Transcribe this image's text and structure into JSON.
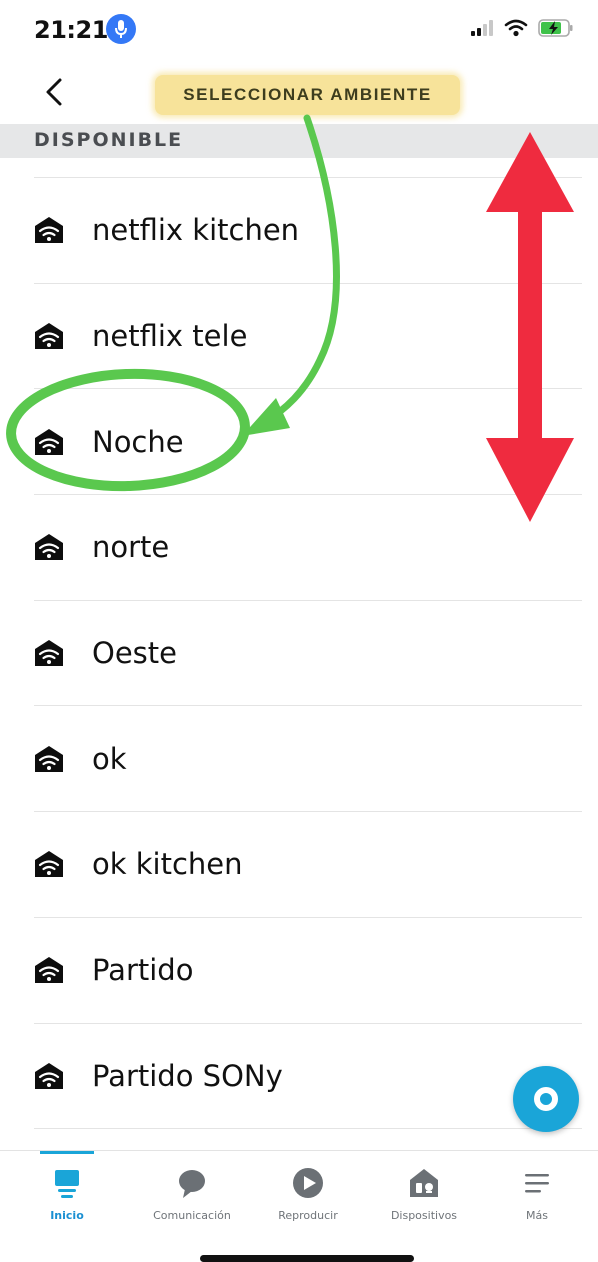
{
  "status": {
    "time": "21:21"
  },
  "header": {
    "title": "SELECCIONAR AMBIENTE"
  },
  "section": {
    "title": "DISPONIBLE"
  },
  "items": [
    {
      "label": "netflix kitchen"
    },
    {
      "label": "netflix tele"
    },
    {
      "label": "Noche"
    },
    {
      "label": "norte"
    },
    {
      "label": "Oeste"
    },
    {
      "label": "ok"
    },
    {
      "label": "ok kitchen"
    },
    {
      "label": "Partido"
    },
    {
      "label": "Partido SONy"
    }
  ],
  "nav": {
    "items": [
      {
        "label": "Inicio",
        "icon": "home-screen-icon",
        "active": true
      },
      {
        "label": "Comunicación",
        "icon": "chat-bubble-icon"
      },
      {
        "label": "Reproducir",
        "icon": "play-icon"
      },
      {
        "label": "Dispositivos",
        "icon": "devices-house-icon"
      },
      {
        "label": "Más",
        "icon": "menu-lines-icon"
      }
    ]
  },
  "colors": {
    "accent": "#1aa5d8",
    "highlight": "#f7e39a",
    "annotation_green": "#5ac84e",
    "annotation_red": "#ef2b3f"
  }
}
